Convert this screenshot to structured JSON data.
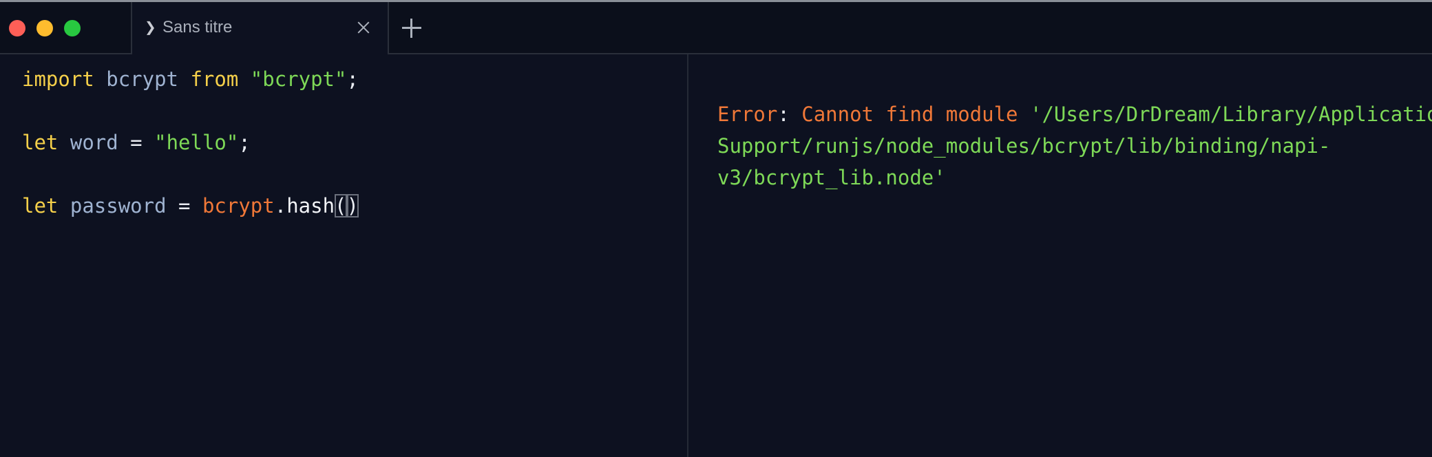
{
  "tab": {
    "chevron": "❯",
    "title": "Sans titre"
  },
  "editor": {
    "line1": {
      "kw1": "import",
      "id": "bcrypt",
      "kw2": "from",
      "str": "\"bcrypt\"",
      "end": ";"
    },
    "line2": {
      "kw": "let",
      "id": "word",
      "op": "=",
      "str": "\"hello\"",
      "end": ";"
    },
    "line3": {
      "kw": "let",
      "id": "password",
      "op": "=",
      "obj": "bcrypt",
      "dot": ".",
      "fn": "hash",
      "open": "(",
      "close": ")"
    }
  },
  "output": {
    "error_label": "Error",
    "colon": ":",
    "message": "Cannot find module",
    "path_line1": "'/Users/DrDream/Library/Application",
    "path_line2": "Support/runjs/node_modules/bcrypt/lib/binding/napi-",
    "path_line3": "v3/bcrypt_lib.node'"
  },
  "colors": {
    "keyword": "#f5d04a",
    "identifier": "#9fb3d1",
    "string": "#7ed957",
    "object": "#f07838",
    "error": "#f07838",
    "background": "#0d1120"
  }
}
